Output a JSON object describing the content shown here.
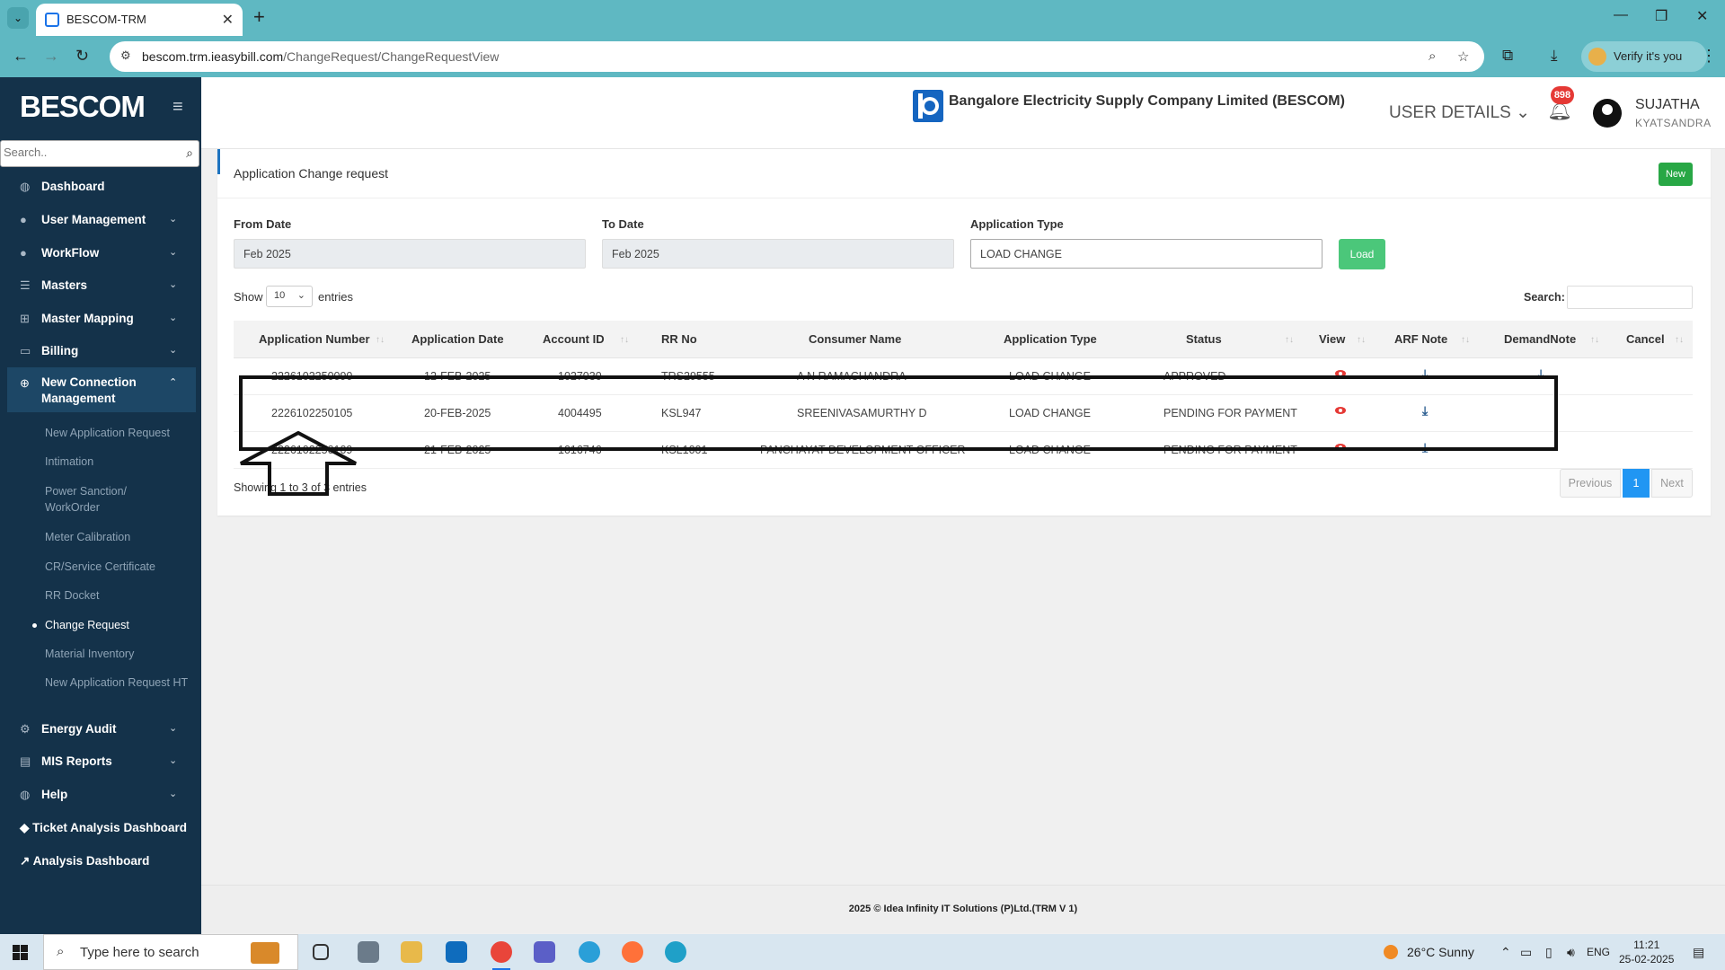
{
  "browser": {
    "tab_title": "BESCOM-TRM",
    "url_host": "bescom.trm.ieasybill.com",
    "url_path": "/ChangeRequest/ChangeRequestView",
    "verify_label": "Verify it's you"
  },
  "sidebar": {
    "brand": "BESCOM",
    "search_placeholder": "Search..",
    "items": [
      {
        "label": "Dashboard",
        "icon": "palette-icon"
      },
      {
        "label": "User Management",
        "icon": "user-icon"
      },
      {
        "label": "WorkFlow",
        "icon": "user-icon"
      },
      {
        "label": "Masters",
        "icon": "list-icon"
      },
      {
        "label": "Master Mapping",
        "icon": "sitemap-icon"
      },
      {
        "label": "Billing",
        "icon": "screen-icon"
      }
    ],
    "open_section": "New Connection Management",
    "sub_items": [
      "New Application Request",
      "Intimation",
      "Power Sanction/ WorkOrder",
      "Meter Calibration",
      "CR/Service Certificate",
      "RR Docket",
      "Change Request",
      "Material Inventory",
      "New Application Request HT"
    ],
    "active_sub": "Change Request",
    "items_after": [
      {
        "label": "Energy Audit",
        "icon": "cogs-icon"
      },
      {
        "label": "MIS Reports",
        "icon": "report-icon"
      },
      {
        "label": "Help",
        "icon": "palette-icon"
      }
    ],
    "bottom_links": [
      "Ticket Analysis Dashboard",
      "Analysis Dashboard"
    ]
  },
  "header": {
    "org_name": "Bangalore Electricity Supply Company Limited (BESCOM)",
    "user_details": "USER DETAILS",
    "notification_count": "898",
    "user_name": "SUJATHA",
    "user_location": "KYATSANDRA"
  },
  "card": {
    "title": "Application Change request",
    "new_button": "New",
    "from_date_label": "From Date",
    "from_date_value": "Feb 2025",
    "to_date_label": "To Date",
    "to_date_value": "Feb 2025",
    "app_type_label": "Application Type",
    "app_type_value": "LOAD CHANGE",
    "load_button": "Load",
    "show_label": "Show",
    "page_size": "10",
    "entries_label": "entries",
    "search_label": "Search:"
  },
  "table": {
    "columns": [
      "Application Number",
      "Application Date",
      "Account ID",
      "RR No",
      "Consumer Name",
      "Application Type",
      "Status",
      "View",
      "ARF Note",
      "DemandNote",
      "Cancel"
    ],
    "rows": [
      [
        "2226102250090",
        "12-FEB-2025",
        "1027030",
        "TRS29555",
        "A N RAMACHANDRA",
        "LOAD CHANGE",
        "APPROVED"
      ],
      [
        "2226102250105",
        "20-FEB-2025",
        "4004495",
        "KSL947",
        "SREENIVASAMURTHY D",
        "LOAD CHANGE",
        "PENDING FOR PAYMENT"
      ],
      [
        "2226102250109",
        "21-FEB-2025",
        "1016746",
        "KSL1001",
        "PANCHAYAT DEVELOPMENT OFFICER",
        "LOAD CHANGE",
        "PENDING FOR PAYMENT"
      ]
    ],
    "showing_text": "Showing 1 to 3 of 3 entries",
    "prev_label": "Previous",
    "current_page": "1",
    "next_label": "Next"
  },
  "footer": {
    "text": "2025 © Idea Infinity IT Solutions (P)Ltd.(TRM V 1)"
  },
  "taskbar": {
    "search_placeholder": "Type here to search",
    "weather": "26°C  Sunny",
    "language": "ENG",
    "time": "11:21",
    "date": "25-02-2025"
  },
  "colors": {
    "sidebar_bg": "#14324a",
    "browser_bar": "#5fb8c2",
    "accent_blue": "#1e74c0",
    "button_green": "#28a745",
    "eye_red": "#e53935"
  }
}
